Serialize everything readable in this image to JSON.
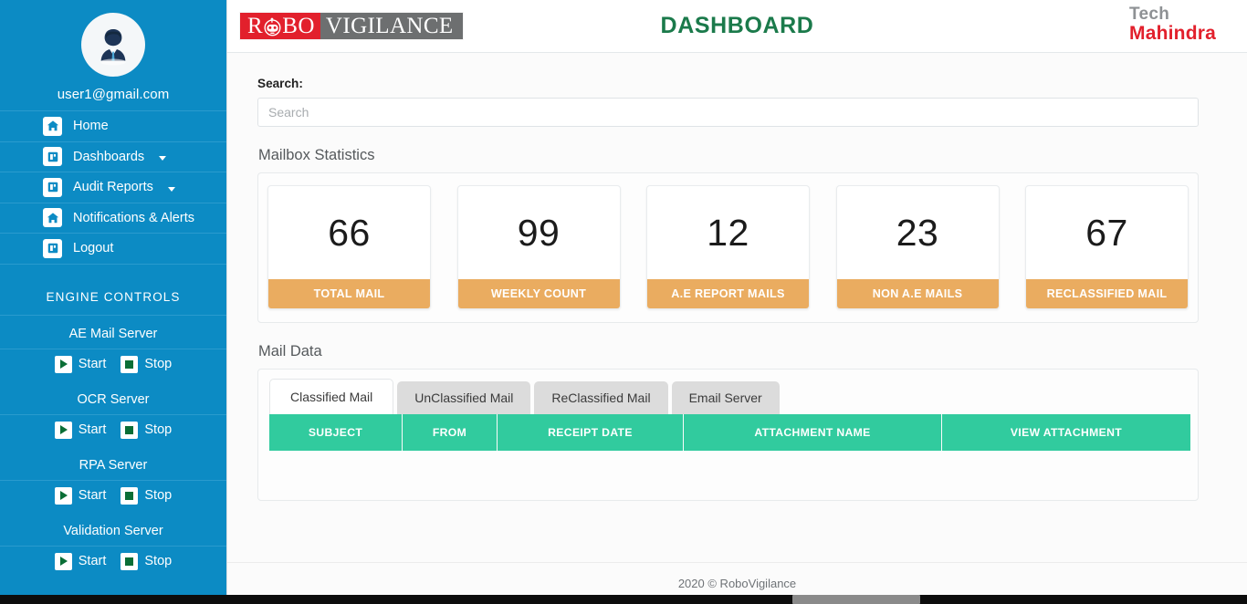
{
  "sidebar": {
    "avatar_icon": "user-avatar-icon",
    "user_email": "user1@gmail.com",
    "menu": [
      {
        "label": "Home",
        "icon": "home-icon",
        "has_caret": false
      },
      {
        "label": "Dashboards",
        "icon": "dashboard-icon",
        "has_caret": true
      },
      {
        "label": "Audit Reports",
        "icon": "report-icon",
        "has_caret": true
      },
      {
        "label": "Notifications & Alerts",
        "icon": "home-icon",
        "has_caret": false
      },
      {
        "label": "Logout",
        "icon": "logout-icon",
        "has_caret": false
      }
    ],
    "engine_controls_title": "ENGINE CONTROLS",
    "start_label": "Start",
    "stop_label": "Stop",
    "servers": [
      {
        "name": "AE Mail Server"
      },
      {
        "name": "OCR Server"
      },
      {
        "name": "RPA Server"
      },
      {
        "name": "Validation Server"
      }
    ]
  },
  "header": {
    "logo_red_text": "R",
    "logo_red_text2": "BO",
    "logo_gray_text": "VIGILANCE",
    "robot_icon": "robot-face-icon",
    "title": "DASHBOARD",
    "brand_top": "Tech",
    "brand_bottom": "Mahindra"
  },
  "search": {
    "label": "Search:",
    "placeholder": "Search",
    "value": ""
  },
  "stats": {
    "section_title": "Mailbox Statistics",
    "cards": [
      {
        "value": "66",
        "label": "TOTAL MAIL"
      },
      {
        "value": "99",
        "label": "WEEKLY COUNT"
      },
      {
        "value": "12",
        "label": "A.E REPORT MAILS"
      },
      {
        "value": "23",
        "label": "NON A.E MAILS"
      },
      {
        "value": "67",
        "label": "RECLASSIFIED MAIL"
      }
    ]
  },
  "mail_data": {
    "section_title": "Mail Data",
    "tabs": [
      {
        "label": "Classified Mail",
        "active": true
      },
      {
        "label": "UnClassified Mail",
        "active": false
      },
      {
        "label": "ReClassified Mail",
        "active": false
      },
      {
        "label": "Email Server",
        "active": false
      }
    ],
    "columns": [
      "SUBJECT",
      "FROM",
      "RECEIPT DATE",
      "ATTACHMENT NAME",
      "VIEW ATTACHMENT"
    ],
    "rows": []
  },
  "footer": {
    "text": "2020 © RoboVigilance"
  },
  "colors": {
    "sidebar_blue": "#0c8bc4",
    "accent_orange": "#eaac60",
    "table_green": "#31cb9e",
    "brand_red": "#e2202c",
    "title_green": "#1b7a4b",
    "tab_gray": "#dcdcdc"
  }
}
